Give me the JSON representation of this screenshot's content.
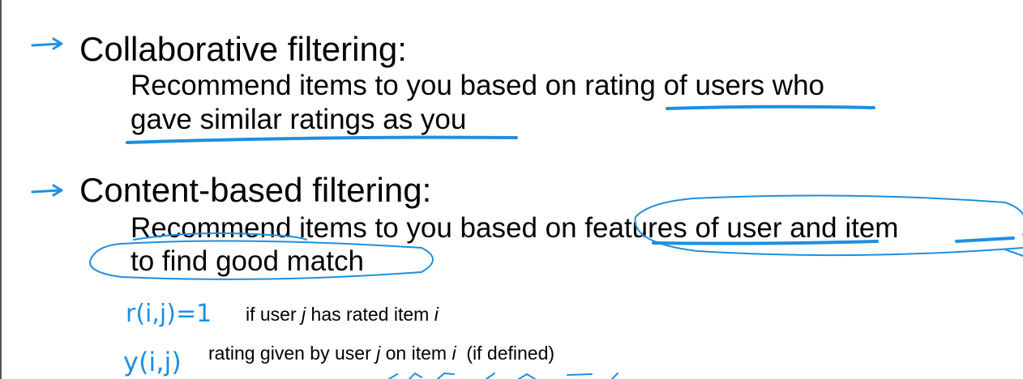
{
  "colors": {
    "ink": "#1f8fe0",
    "text": "#000000",
    "background": "#ffffff"
  },
  "icons": {
    "bullet": "arrow-right-icon"
  },
  "sections": [
    {
      "heading": "Collaborative filtering:",
      "lines": [
        "Recommend items to you based on rating of users who",
        "gave similar ratings as you"
      ]
    },
    {
      "heading": "Content-based filtering:",
      "lines": [
        "Recommend items to you based on features of user and item",
        "to find good match"
      ]
    }
  ],
  "notations": [
    {
      "symbol": "r(i,j)=1",
      "desc_parts": [
        "if user ",
        "j",
        " has rated item ",
        "i"
      ]
    },
    {
      "symbol": "y(i,j)",
      "desc_parts": [
        "rating given by user ",
        "j",
        " on item ",
        "i",
        "  (if defined)"
      ]
    }
  ]
}
